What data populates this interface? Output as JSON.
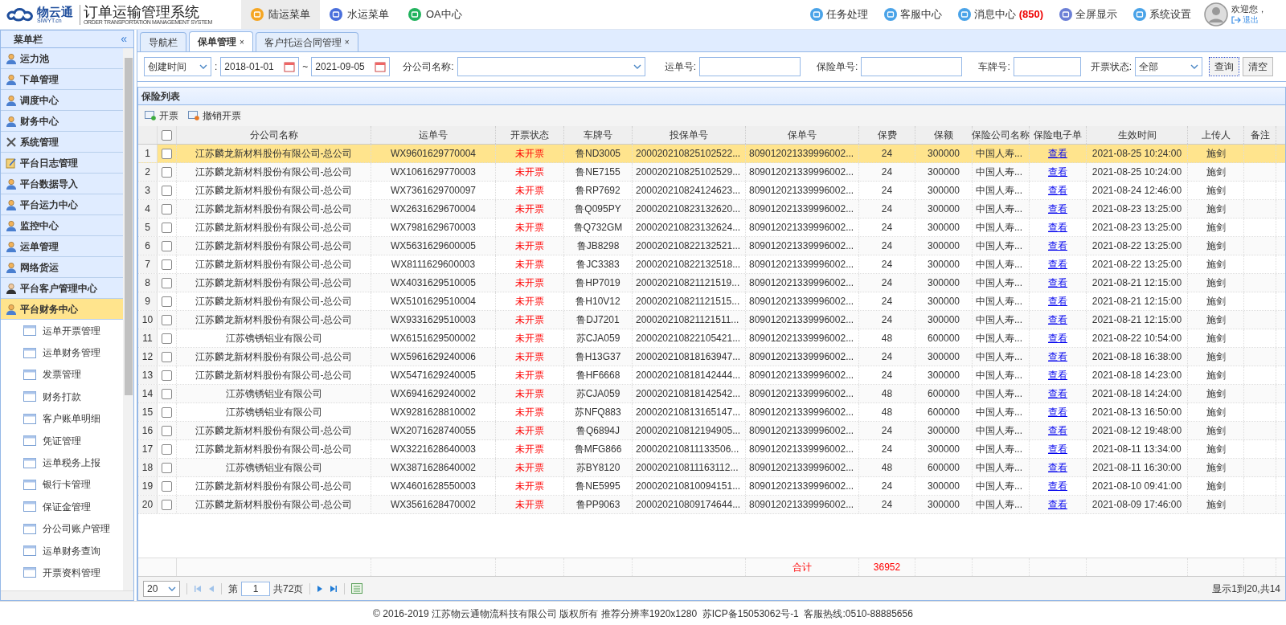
{
  "header": {
    "logo_name": "物云通",
    "logo_domain": "SIWYT.cn",
    "system_title": "订单运输管理系统",
    "system_subtitle": "ORDER TRANSPORTATION MANAGEMENT SYSTEM",
    "menus": [
      {
        "label": "陆运菜单",
        "kind": "land",
        "selected": true
      },
      {
        "label": "水运菜单",
        "kind": "water",
        "selected": false
      },
      {
        "label": "OA中心",
        "kind": "oa",
        "selected": false
      }
    ],
    "actions": [
      {
        "label": "任务处理",
        "kind": "task"
      },
      {
        "label": "客服中心",
        "kind": "service"
      },
      {
        "label": "消息中心",
        "count": "(850)",
        "kind": "message"
      },
      {
        "label": "全屏显示",
        "kind": "fullscreen"
      },
      {
        "label": "系统设置",
        "kind": "settings"
      }
    ],
    "welcome": "欢迎您，",
    "logout": "退出"
  },
  "sidebar": {
    "title": "菜单栏",
    "collapse": "«",
    "groups": [
      {
        "label": "运力池",
        "kind": "user",
        "selected": false
      },
      {
        "label": "下单管理",
        "kind": "user",
        "selected": false
      },
      {
        "label": "调度中心",
        "kind": "user",
        "selected": false
      },
      {
        "label": "财务中心",
        "kind": "user",
        "selected": false
      },
      {
        "label": "系统管理",
        "kind": "tools",
        "selected": false
      },
      {
        "label": "平台日志管理",
        "kind": "log",
        "selected": false
      },
      {
        "label": "平台数据导入",
        "kind": "user",
        "selected": false
      },
      {
        "label": "平台运力中心",
        "kind": "user",
        "selected": false
      },
      {
        "label": "监控中心",
        "kind": "user",
        "selected": false
      },
      {
        "label": "运单管理",
        "kind": "user",
        "selected": false
      },
      {
        "label": "网络货运",
        "kind": "user",
        "selected": false
      },
      {
        "label": "平台客户管理中心",
        "kind": "manager",
        "selected": false
      },
      {
        "label": "平台财务中心",
        "kind": "user",
        "selected": true,
        "children": [
          "运单开票管理",
          "运单财务管理",
          "发票管理",
          "财务打款",
          "客户账单明细",
          "凭证管理",
          "运单税务上报",
          "银行卡管理",
          "保证金管理",
          "分公司账户管理",
          "运单财务查询",
          "开票资料管理"
        ]
      }
    ]
  },
  "tabs": [
    {
      "label": "导航栏",
      "selected": false
    },
    {
      "label": "保单管理",
      "close": "×",
      "selected": true
    },
    {
      "label": "客户托运合同管理",
      "close": "×",
      "selected": false
    }
  ],
  "filters": {
    "date_type": "创建时间",
    "date_colon": ":",
    "date_from": "2018-01-01",
    "date_sep": "~",
    "date_to": "2021-09-05",
    "company_label": "分公司名称:",
    "waybill_label": "运单号:",
    "policy_label": "保险单号:",
    "plate_label": "车牌号:",
    "status_label": "开票状态:",
    "status_value": "全部",
    "search": "查询",
    "clear": "清空"
  },
  "panel": {
    "title": "保险列表",
    "toolbar": [
      {
        "label": "开票",
        "kind": "add"
      },
      {
        "label": "撤销开票",
        "kind": "remove"
      }
    ]
  },
  "table": {
    "columns": [
      {
        "label": "分公司名称",
        "kind": "text"
      },
      {
        "label": "运单号",
        "kind": "text"
      },
      {
        "label": "开票状态",
        "kind": "status"
      },
      {
        "label": "车牌号",
        "kind": "text"
      },
      {
        "label": "投保单号",
        "kind": "left"
      },
      {
        "label": "保单号",
        "kind": "left"
      },
      {
        "label": "保费",
        "kind": "text"
      },
      {
        "label": "保额",
        "kind": "text"
      },
      {
        "label": "保险公司名称",
        "kind": "left"
      },
      {
        "label": "保险电子单",
        "kind": "link"
      },
      {
        "label": "生效时间",
        "kind": "text"
      },
      {
        "label": "上传人",
        "kind": "text"
      },
      {
        "label": "备注"
      }
    ],
    "all_checked": false,
    "rows": [
      {
        "no": "1",
        "selected": true,
        "checked": false,
        "cells": [
          "江苏麟龙新材料股份有限公司-总公司",
          "WX9601629770004",
          "未开票",
          "鲁ND3005",
          "200020210825102522...",
          "809012021339996002...",
          "24",
          "300000",
          "中国人寿...",
          "查看",
          "2021-08-25 10:24:00",
          "施剑"
        ]
      },
      {
        "no": "2",
        "selected": false,
        "checked": false,
        "cells": [
          "江苏麟龙新材料股份有限公司-总公司",
          "WX1061629770003",
          "未开票",
          "鲁NE7155",
          "200020210825102529...",
          "809012021339996002...",
          "24",
          "300000",
          "中国人寿...",
          "查看",
          "2021-08-25 10:24:00",
          "施剑"
        ]
      },
      {
        "no": "3",
        "selected": false,
        "checked": false,
        "cells": [
          "江苏麟龙新材料股份有限公司-总公司",
          "WX7361629700097",
          "未开票",
          "鲁RP7692",
          "200020210824124623...",
          "809012021339996002...",
          "24",
          "300000",
          "中国人寿...",
          "查看",
          "2021-08-24 12:46:00",
          "施剑"
        ]
      },
      {
        "no": "4",
        "selected": false,
        "checked": false,
        "cells": [
          "江苏麟龙新材料股份有限公司-总公司",
          "WX2631629670004",
          "未开票",
          "鲁Q095PY",
          "200020210823132620...",
          "809012021339996002...",
          "24",
          "300000",
          "中国人寿...",
          "查看",
          "2021-08-23 13:25:00",
          "施剑"
        ]
      },
      {
        "no": "5",
        "selected": false,
        "checked": false,
        "cells": [
          "江苏麟龙新材料股份有限公司-总公司",
          "WX7981629670003",
          "未开票",
          "鲁Q732GM",
          "200020210823132624...",
          "809012021339996002...",
          "24",
          "300000",
          "中国人寿...",
          "查看",
          "2021-08-23 13:25:00",
          "施剑"
        ]
      },
      {
        "no": "6",
        "selected": false,
        "checked": false,
        "cells": [
          "江苏麟龙新材料股份有限公司-总公司",
          "WX5631629600005",
          "未开票",
          "鲁JB8298",
          "200020210822132521...",
          "809012021339996002...",
          "24",
          "300000",
          "中国人寿...",
          "查看",
          "2021-08-22 13:25:00",
          "施剑"
        ]
      },
      {
        "no": "7",
        "selected": false,
        "checked": false,
        "cells": [
          "江苏麟龙新材料股份有限公司-总公司",
          "WX8111629600003",
          "未开票",
          "鲁JC3383",
          "200020210822132518...",
          "809012021339996002...",
          "24",
          "300000",
          "中国人寿...",
          "查看",
          "2021-08-22 13:25:00",
          "施剑"
        ]
      },
      {
        "no": "8",
        "selected": false,
        "checked": false,
        "cells": [
          "江苏麟龙新材料股份有限公司-总公司",
          "WX4031629510005",
          "未开票",
          "鲁HP7019",
          "200020210821121519...",
          "809012021339996002...",
          "24",
          "300000",
          "中国人寿...",
          "查看",
          "2021-08-21 12:15:00",
          "施剑"
        ]
      },
      {
        "no": "9",
        "selected": false,
        "checked": false,
        "cells": [
          "江苏麟龙新材料股份有限公司-总公司",
          "WX5101629510004",
          "未开票",
          "鲁H10V12",
          "200020210821121515...",
          "809012021339996002...",
          "24",
          "300000",
          "中国人寿...",
          "查看",
          "2021-08-21 12:15:00",
          "施剑"
        ]
      },
      {
        "no": "10",
        "selected": false,
        "checked": false,
        "cells": [
          "江苏麟龙新材料股份有限公司-总公司",
          "WX9331629510003",
          "未开票",
          "鲁DJ7201",
          "200020210821121511...",
          "809012021339996002...",
          "24",
          "300000",
          "中国人寿...",
          "查看",
          "2021-08-21 12:15:00",
          "施剑"
        ]
      },
      {
        "no": "11",
        "selected": false,
        "checked": false,
        "cells": [
          "江苏镌锈铝业有限公司",
          "WX6151629500002",
          "未开票",
          "苏CJA059",
          "200020210822105421...",
          "809012021339996002...",
          "48",
          "600000",
          "中国人寿...",
          "查看",
          "2021-08-22 10:54:00",
          "施剑"
        ]
      },
      {
        "no": "12",
        "selected": false,
        "checked": false,
        "cells": [
          "江苏麟龙新材料股份有限公司-总公司",
          "WX5961629240006",
          "未开票",
          "鲁H13G37",
          "200020210818163947...",
          "809012021339996002...",
          "24",
          "300000",
          "中国人寿...",
          "查看",
          "2021-08-18 16:38:00",
          "施剑"
        ]
      },
      {
        "no": "13",
        "selected": false,
        "checked": false,
        "cells": [
          "江苏麟龙新材料股份有限公司-总公司",
          "WX5471629240005",
          "未开票",
          "鲁HF6668",
          "200020210818142444...",
          "809012021339996002...",
          "24",
          "300000",
          "中国人寿...",
          "查看",
          "2021-08-18 14:23:00",
          "施剑"
        ]
      },
      {
        "no": "14",
        "selected": false,
        "checked": false,
        "cells": [
          "江苏镌锈铝业有限公司",
          "WX6941629240002",
          "未开票",
          "苏CJA059",
          "200020210818142542...",
          "809012021339996002...",
          "48",
          "600000",
          "中国人寿...",
          "查看",
          "2021-08-18 14:24:00",
          "施剑"
        ]
      },
      {
        "no": "15",
        "selected": false,
        "checked": false,
        "cells": [
          "江苏镌锈铝业有限公司",
          "WX9281628810002",
          "未开票",
          "苏NFQ883",
          "200020210813165147...",
          "809012021339996002...",
          "48",
          "600000",
          "中国人寿...",
          "查看",
          "2021-08-13 16:50:00",
          "施剑"
        ]
      },
      {
        "no": "16",
        "selected": false,
        "checked": false,
        "cells": [
          "江苏麟龙新材料股份有限公司-总公司",
          "WX2071628740055",
          "未开票",
          "鲁Q6894J",
          "200020210812194905...",
          "809012021339996002...",
          "24",
          "300000",
          "中国人寿...",
          "查看",
          "2021-08-12 19:48:00",
          "施剑"
        ]
      },
      {
        "no": "17",
        "selected": false,
        "checked": false,
        "cells": [
          "江苏麟龙新材料股份有限公司-总公司",
          "WX3221628640003",
          "未开票",
          "鲁MFG866",
          "200020210811133506...",
          "809012021339996002...",
          "24",
          "300000",
          "中国人寿...",
          "查看",
          "2021-08-11 13:34:00",
          "施剑"
        ]
      },
      {
        "no": "18",
        "selected": false,
        "checked": false,
        "cells": [
          "江苏镌锈铝业有限公司",
          "WX3871628640002",
          "未开票",
          "苏BY8120",
          "200020210811163112...",
          "809012021339996002...",
          "48",
          "600000",
          "中国人寿...",
          "查看",
          "2021-08-11 16:30:00",
          "施剑"
        ]
      },
      {
        "no": "19",
        "selected": false,
        "checked": false,
        "cells": [
          "江苏麟龙新材料股份有限公司-总公司",
          "WX4601628550003",
          "未开票",
          "鲁NE5995",
          "200020210810094151...",
          "809012021339996002...",
          "24",
          "300000",
          "中国人寿...",
          "查看",
          "2021-08-10 09:41:00",
          "施剑"
        ]
      },
      {
        "no": "20",
        "selected": false,
        "checked": false,
        "cells": [
          "江苏麟龙新材料股份有限公司-总公司",
          "WX3561628470002",
          "未开票",
          "鲁PP9063",
          "200020210809174644...",
          "809012021339996002...",
          "24",
          "300000",
          "中国人寿...",
          "查看",
          "2021-08-09 17:46:00",
          "施剑"
        ]
      }
    ],
    "footer_row": {
      "label": "合计",
      "total": "36952"
    }
  },
  "pager": {
    "page_size": "20",
    "page_label": "第",
    "page": "1",
    "page_count": "共72页",
    "summary": "显示1到20,共14"
  },
  "footer": "© 2016-2019 江苏物云通物流科技有限公司 版权所有 推荐分辨率1920x1280  苏ICP备15053062号-1  客服热线:0510-88885656"
}
